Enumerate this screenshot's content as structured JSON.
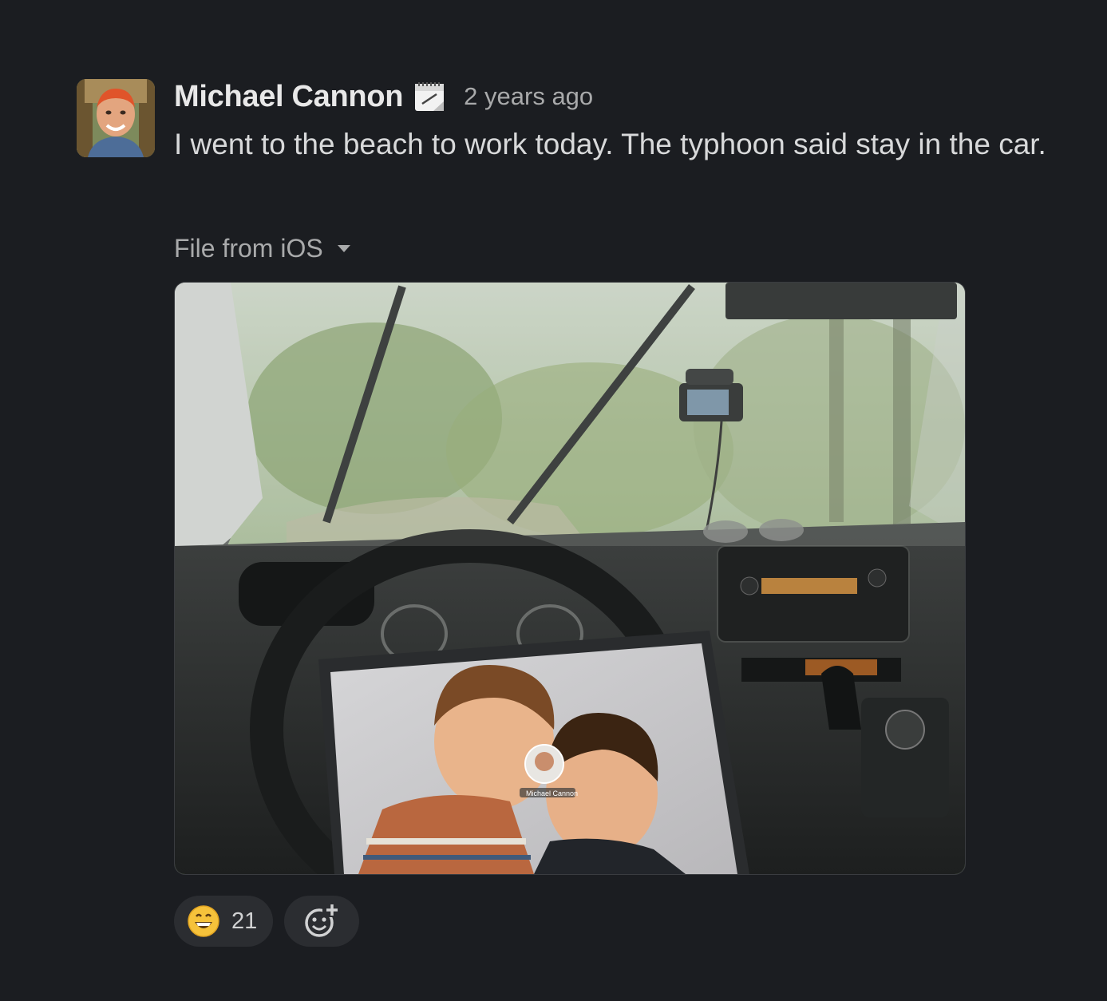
{
  "message": {
    "author": "Michael Cannon",
    "status_icon": "calendar-icon",
    "timestamp": "2 years ago",
    "text": "I went to the beach to work today. The typhoon said stay in the car."
  },
  "attachment": {
    "source_label": "File from iOS",
    "dropdown_icon": "caret-down-icon",
    "image_overlay_name": "Michael Cannon"
  },
  "reactions": [
    {
      "emoji_icon": "grinning-face-icon",
      "count": "21"
    }
  ],
  "add_reaction_icon": "add-emoji-icon",
  "colors": {
    "background": "#1b1d21",
    "text": "#d1d2d3",
    "muted": "#a9aaab",
    "pill": "#2b2d31"
  }
}
